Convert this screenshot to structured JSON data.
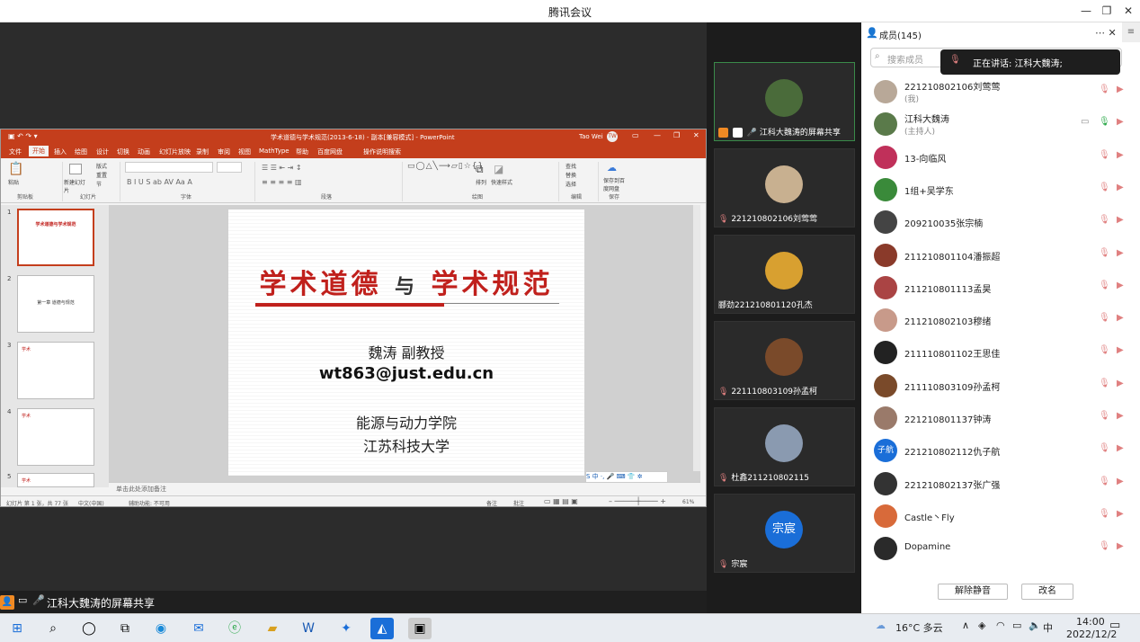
{
  "window": {
    "title": "腾讯会议"
  },
  "share_label": "江科大魏涛的屏幕共享",
  "ppt": {
    "window_title": "学术道德与学术规范(2013-6-18)  -  副本[兼容模式]  -  PowerPoint",
    "user": "Tao Wei",
    "user_initials": "TW",
    "tabs": [
      "文件",
      "开始",
      "插入",
      "绘图",
      "设计",
      "切换",
      "动画",
      "幻灯片放映",
      "录制",
      "审阅",
      "视图",
      "MathType",
      "帮助",
      "百度网盘",
      "操作说明搜索"
    ],
    "ribbon_groups": [
      "剪贴板",
      "幻灯片",
      "字体",
      "段落",
      "绘图",
      "编辑",
      "保存"
    ],
    "ribbon_labels": {
      "paste": "粘贴",
      "new_slide": "新建幻灯片",
      "layout": "版式",
      "reset": "重置",
      "section": "节",
      "arrange": "排列",
      "quick_styles": "快速样式",
      "find": "查找",
      "replace": "替换",
      "select": "选择",
      "save_baidu": "保存到百度网盘"
    },
    "slide": {
      "title_left": "学术道德",
      "title_mid": "与",
      "title_right": "学术规范",
      "author": "魏涛     副教授",
      "email": "wt863@just.edu.cn",
      "institute": "能源与动力学院",
      "university": "江苏科技大学"
    },
    "thumbnails": [
      {
        "num": "1",
        "text": "学术道德与学术规范"
      },
      {
        "num": "2",
        "text": "第一章  道德与规范"
      },
      {
        "num": "3",
        "text": "学术"
      },
      {
        "num": "4",
        "text": "学术"
      },
      {
        "num": "5",
        "text": "学术"
      }
    ],
    "notes_placeholder": "单击此处添加备注",
    "status_left": "幻灯片 第 1 张，共 77 张",
    "status_lang": "中文(中国)",
    "status_access": "辅助功能: 不可用",
    "status_notes": "备注",
    "status_comments": "批注",
    "zoom": "61%",
    "ime": "S 中 ·, 🎤 ⌨ 👕 ✲"
  },
  "tiles": [
    {
      "name": "江科大魏涛的屏幕共享",
      "color": "#4a6b3a"
    },
    {
      "name": "221210802106刘莺莺",
      "color": "#c8b090"
    },
    {
      "name": "郦劲221210801120孔杰",
      "color": "#d8a030"
    },
    {
      "name": "221110803109孙孟柯",
      "color": "#7a4a2a"
    },
    {
      "name": "杜鑫211210802115",
      "color": "#8a9ab0"
    },
    {
      "name": "宗宸",
      "initial": "宗宸",
      "color": "#1a6ed8"
    }
  ],
  "panel": {
    "title": "成员(145)",
    "search_placeholder": "搜索成员",
    "speaking": "正在讲话: 江科大魏涛;",
    "members": [
      {
        "name": "221210802106刘莺莺",
        "sub": "(我)",
        "color": "#b8a898"
      },
      {
        "name": "江科大魏涛",
        "sub": "(主持人)",
        "color": "#5a7a4a"
      },
      {
        "name": "13-向临风",
        "color": "#c0305a"
      },
      {
        "name": "1组+吴学东",
        "color": "#3a8a3a"
      },
      {
        "name": "209210035张宗楠",
        "color": "#444444"
      },
      {
        "name": "211210801104潘振超",
        "color": "#8a3a2a"
      },
      {
        "name": "211210801113孟昊",
        "color": "#aa4444"
      },
      {
        "name": "211210802103穆绪",
        "color": "#c89a8a"
      },
      {
        "name": "211110801102王思佳",
        "color": "#222222"
      },
      {
        "name": "211110803109孙孟柯",
        "color": "#7a4a2a"
      },
      {
        "name": "221210801137钟涛",
        "color": "#9a7a6a"
      },
      {
        "name": "221210802112仇子航",
        "initial": "子航",
        "color": "#1a6ed8"
      },
      {
        "name": "221210802137张广强",
        "color": "#333333"
      },
      {
        "name": "Castle丶Fly",
        "color": "#d86a3a"
      },
      {
        "name": "Dopamine",
        "color": "#2a2a2a"
      }
    ],
    "unmute_all": "解除静音",
    "rename": "改名"
  },
  "taskbar": {
    "weather": "16°C 多云",
    "ime": "中",
    "time": "14:00",
    "date": "2022/12/2"
  }
}
